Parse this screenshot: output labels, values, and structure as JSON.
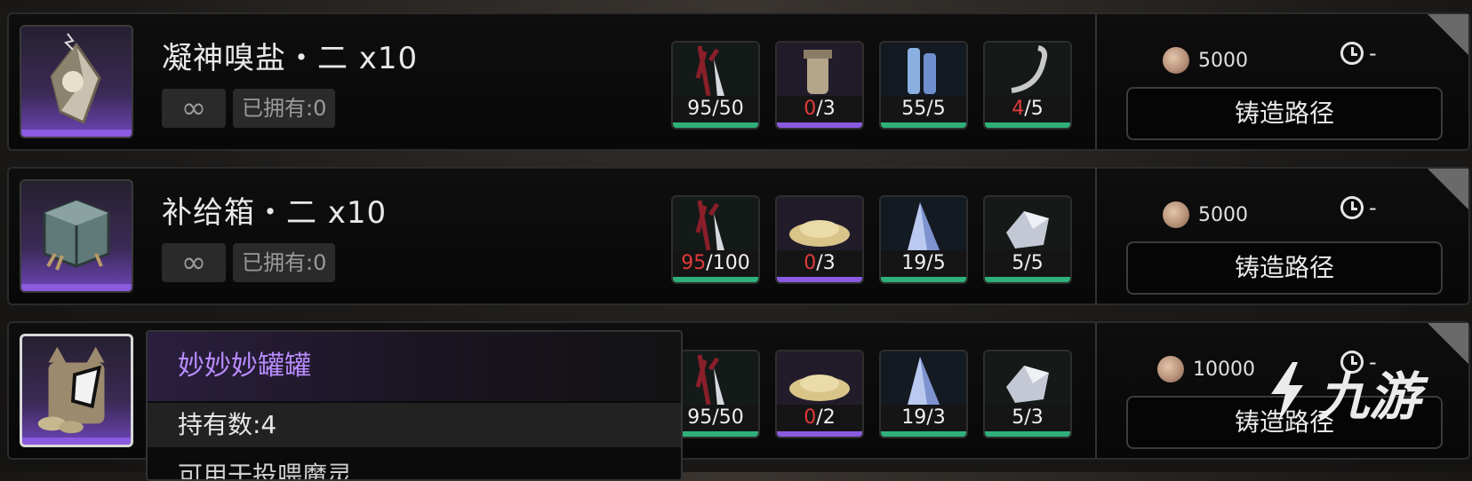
{
  "rows": [
    {
      "name": "凝神嗅盐・二 x10",
      "infinity": "∞",
      "owned": "已拥有:0",
      "materials": [
        {
          "have": "95",
          "need": "/50",
          "short": false,
          "bar": "green",
          "icon": "red-thorn-crystal"
        },
        {
          "have": "0",
          "need": "/3",
          "short": true,
          "bar": "purple",
          "icon": "bolt-canister"
        },
        {
          "have": "55",
          "need": "/5",
          "short": false,
          "bar": "green",
          "icon": "glass-vials"
        },
        {
          "have": "4",
          "need": "/5",
          "short": true,
          "bar": "green",
          "icon": "silver-hook"
        }
      ],
      "cost": "5000",
      "time": "-",
      "button": "铸造路径"
    },
    {
      "name": "补给箱・二 x10",
      "infinity": "∞",
      "owned": "已拥有:0",
      "materials": [
        {
          "have": "95",
          "need": "/100",
          "short": true,
          "bar": "green",
          "icon": "red-thorn-crystal"
        },
        {
          "have": "0",
          "need": "/3",
          "short": true,
          "bar": "purple",
          "icon": "gold-sand"
        },
        {
          "have": "19",
          "need": "/5",
          "short": false,
          "bar": "green",
          "icon": "blue-crystal"
        },
        {
          "have": "5",
          "need": "/5",
          "short": false,
          "bar": "green",
          "icon": "silver-ore"
        }
      ],
      "cost": "5000",
      "time": "-",
      "button": "铸造路径"
    },
    {
      "name": "",
      "materials": [
        {
          "have": "95",
          "need": "/50",
          "short": false,
          "bar": "green",
          "icon": "red-thorn-crystal"
        },
        {
          "have": "0",
          "need": "/2",
          "short": true,
          "bar": "purple",
          "icon": "gold-sand"
        },
        {
          "have": "19",
          "need": "/3",
          "short": false,
          "bar": "green",
          "icon": "blue-crystal"
        },
        {
          "have": "5",
          "need": "/3",
          "short": false,
          "bar": "green",
          "icon": "silver-ore"
        }
      ],
      "cost": "10000",
      "time": "-",
      "button": "铸造路径"
    }
  ],
  "tooltip": {
    "title": "妙妙妙罐罐",
    "quantity": "持有数:4",
    "description": "可用于投喂魔灵"
  },
  "watermark": {
    "text": "九游"
  },
  "colors": {
    "shortage": "#e23a3a",
    "rarity_purple": "#8a5ae0",
    "bar_green": "#2fb07a",
    "tooltip_title": "#b98cff"
  }
}
